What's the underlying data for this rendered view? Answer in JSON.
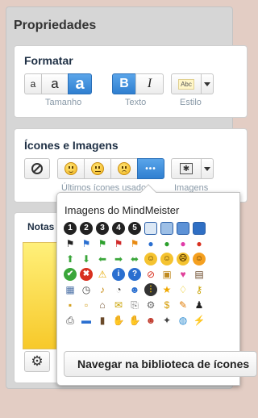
{
  "panel": {
    "title": "Propriedades"
  },
  "format": {
    "title": "Formatar",
    "size_buttons": [
      "a",
      "a",
      "a"
    ],
    "bold_label": "B",
    "italic_label": "I",
    "style_label": "Abc",
    "size_label": "Tamanho",
    "text_label": "Texto",
    "style_caption": "Estilo"
  },
  "icons": {
    "title": "Ícones e Imagens",
    "recent_label": "Últimos ícones usados",
    "images_label": "Imagens",
    "more_label": "•••"
  },
  "notes": {
    "title": "Notas"
  },
  "popup": {
    "title": "Imagens do MindMeister",
    "browse_label": "Navegar na biblioteca de ícones",
    "icon_rows": [
      [
        {
          "name": "number-1-icon",
          "glyph": "1",
          "bg": "#222",
          "fg": "#fff"
        },
        {
          "name": "number-2-icon",
          "glyph": "2",
          "bg": "#222",
          "fg": "#fff"
        },
        {
          "name": "number-3-icon",
          "glyph": "3",
          "bg": "#222",
          "fg": "#fff"
        },
        {
          "name": "number-4-icon",
          "glyph": "4",
          "bg": "#222",
          "fg": "#fff"
        },
        {
          "name": "number-5-icon",
          "glyph": "5",
          "bg": "#222",
          "fg": "#fff"
        },
        {
          "name": "progress-0-icon",
          "glyph": "",
          "bg": "#dce8f5",
          "fg": "#000"
        },
        {
          "name": "progress-25-icon",
          "glyph": "",
          "bg": "#9dbfe6",
          "fg": "#000"
        },
        {
          "name": "progress-50-icon",
          "glyph": "",
          "bg": "#5d92d6",
          "fg": "#000"
        },
        {
          "name": "progress-75-icon",
          "glyph": "",
          "bg": "#2f6fc4",
          "fg": "#000"
        }
      ],
      [
        {
          "name": "flag-black-icon",
          "glyph": "⚑",
          "bg": "",
          "fg": "#222"
        },
        {
          "name": "flag-blue-icon",
          "glyph": "⚑",
          "bg": "",
          "fg": "#2a6fd0"
        },
        {
          "name": "flag-green-icon",
          "glyph": "⚑",
          "bg": "",
          "fg": "#2da02d"
        },
        {
          "name": "flag-red-icon",
          "glyph": "⚑",
          "bg": "",
          "fg": "#d02a2a"
        },
        {
          "name": "flag-orange-icon",
          "glyph": "⚑",
          "bg": "",
          "fg": "#e88a12"
        },
        {
          "name": "dot-blue-icon",
          "glyph": "●",
          "bg": "",
          "fg": "#2a6fd0"
        },
        {
          "name": "dot-green-icon",
          "glyph": "●",
          "bg": "",
          "fg": "#2da02d"
        },
        {
          "name": "dot-pink-icon",
          "glyph": "●",
          "bg": "",
          "fg": "#e03aa8"
        },
        {
          "name": "dot-red-icon",
          "glyph": "●",
          "bg": "",
          "fg": "#d8301f"
        }
      ],
      [
        {
          "name": "arrow-up-icon",
          "glyph": "⬆",
          "bg": "",
          "fg": "#3aa63a"
        },
        {
          "name": "arrow-down-icon",
          "glyph": "⬇",
          "bg": "",
          "fg": "#3aa63a"
        },
        {
          "name": "arrow-left-icon",
          "glyph": "⬅",
          "bg": "",
          "fg": "#3aa63a"
        },
        {
          "name": "arrow-right-icon",
          "glyph": "➡",
          "bg": "",
          "fg": "#3aa63a"
        },
        {
          "name": "arrow-left-right-icon",
          "glyph": "⬌",
          "bg": "",
          "fg": "#3aa63a"
        },
        {
          "name": "smiley-happy-icon",
          "glyph": "☺",
          "bg": "#f5c330",
          "fg": "#5a3a00"
        },
        {
          "name": "smiley-neutral-icon",
          "glyph": "☺",
          "bg": "#f5c330",
          "fg": "#5a3a00"
        },
        {
          "name": "smiley-sad-icon",
          "glyph": "☹",
          "bg": "#f5c330",
          "fg": "#5a3a00"
        },
        {
          "name": "smiley-surprised-icon",
          "glyph": "☺",
          "bg": "#f5a020",
          "fg": "#5a3a00"
        }
      ],
      [
        {
          "name": "check-icon",
          "glyph": "✔",
          "bg": "#3aa63a",
          "fg": "#fff"
        },
        {
          "name": "cross-icon",
          "glyph": "✖",
          "bg": "#d8301f",
          "fg": "#fff"
        },
        {
          "name": "warning-icon",
          "glyph": "⚠",
          "bg": "",
          "fg": "#e6a800"
        },
        {
          "name": "info-icon",
          "glyph": "i",
          "bg": "#2a6fd0",
          "fg": "#fff"
        },
        {
          "name": "question-icon",
          "glyph": "?",
          "bg": "#2a6fd0",
          "fg": "#fff"
        },
        {
          "name": "stop-icon",
          "glyph": "⊘",
          "bg": "",
          "fg": "#d8301f"
        },
        {
          "name": "inbox-icon",
          "glyph": "▣",
          "bg": "",
          "fg": "#c08a20"
        },
        {
          "name": "heart-icon",
          "glyph": "♥",
          "bg": "",
          "fg": "#e0409a"
        },
        {
          "name": "book-icon",
          "glyph": "▤",
          "bg": "",
          "fg": "#6b4a2a"
        }
      ],
      [
        {
          "name": "calendar-icon",
          "glyph": "▦",
          "bg": "",
          "fg": "#4a6fa5"
        },
        {
          "name": "clock-icon",
          "glyph": "◷",
          "bg": "",
          "fg": "#444"
        },
        {
          "name": "bell-icon",
          "glyph": "♪",
          "bg": "",
          "fg": "#c88a10"
        },
        {
          "name": "alarm-icon",
          "glyph": "◔",
          "bg": "",
          "fg": "#444"
        },
        {
          "name": "user-blue-icon",
          "glyph": "☻",
          "bg": "",
          "fg": "#2a6fd0"
        },
        {
          "name": "traffic-light-icon",
          "glyph": "⋮",
          "bg": "#333",
          "fg": "#f0c000"
        },
        {
          "name": "star-icon",
          "glyph": "★",
          "bg": "",
          "fg": "#f0a800"
        },
        {
          "name": "lightbulb-icon",
          "glyph": "♢",
          "bg": "",
          "fg": "#e6c200"
        },
        {
          "name": "key-icon",
          "glyph": "⚷",
          "bg": "",
          "fg": "#c9a200"
        }
      ],
      [
        {
          "name": "lock-icon",
          "glyph": "▪",
          "bg": "",
          "fg": "#d4a020"
        },
        {
          "name": "unlock-icon",
          "glyph": "▫",
          "bg": "",
          "fg": "#d4a020"
        },
        {
          "name": "house-icon",
          "glyph": "⌂",
          "bg": "",
          "fg": "#7a5a3a"
        },
        {
          "name": "mail-icon",
          "glyph": "✉",
          "bg": "",
          "fg": "#c9a200"
        },
        {
          "name": "paperclip-icon",
          "glyph": "⎘",
          "bg": "",
          "fg": "#777"
        },
        {
          "name": "settings-icon",
          "glyph": "⚙",
          "bg": "",
          "fg": "#666"
        },
        {
          "name": "money-icon",
          "glyph": "$",
          "bg": "",
          "fg": "#d49a00"
        },
        {
          "name": "pencil-icon",
          "glyph": "✎",
          "bg": "",
          "fg": "#e07a00"
        },
        {
          "name": "person-icon",
          "glyph": "♟",
          "bg": "",
          "fg": "#222"
        }
      ],
      [
        {
          "name": "printer-icon",
          "glyph": "⎙",
          "bg": "",
          "fg": "#444"
        },
        {
          "name": "folder-blue-icon",
          "glyph": "▬",
          "bg": "",
          "fg": "#2a6fd0"
        },
        {
          "name": "briefcase-icon",
          "glyph": "▮",
          "bg": "",
          "fg": "#6b4a2a"
        },
        {
          "name": "thumbs-up-icon",
          "glyph": "✋",
          "bg": "",
          "fg": "#d9a25a"
        },
        {
          "name": "handshake-icon",
          "glyph": "✋",
          "bg": "",
          "fg": "#e0b070"
        },
        {
          "name": "group-icon",
          "glyph": "☻",
          "bg": "",
          "fg": "#c0392b"
        },
        {
          "name": "magic-wand-icon",
          "glyph": "✦",
          "bg": "",
          "fg": "#444"
        },
        {
          "name": "globe-icon",
          "glyph": "◍",
          "bg": "",
          "fg": "#2a8ad0"
        },
        {
          "name": "lightning-icon",
          "glyph": "⚡",
          "bg": "",
          "fg": "#f0b400"
        }
      ]
    ]
  }
}
